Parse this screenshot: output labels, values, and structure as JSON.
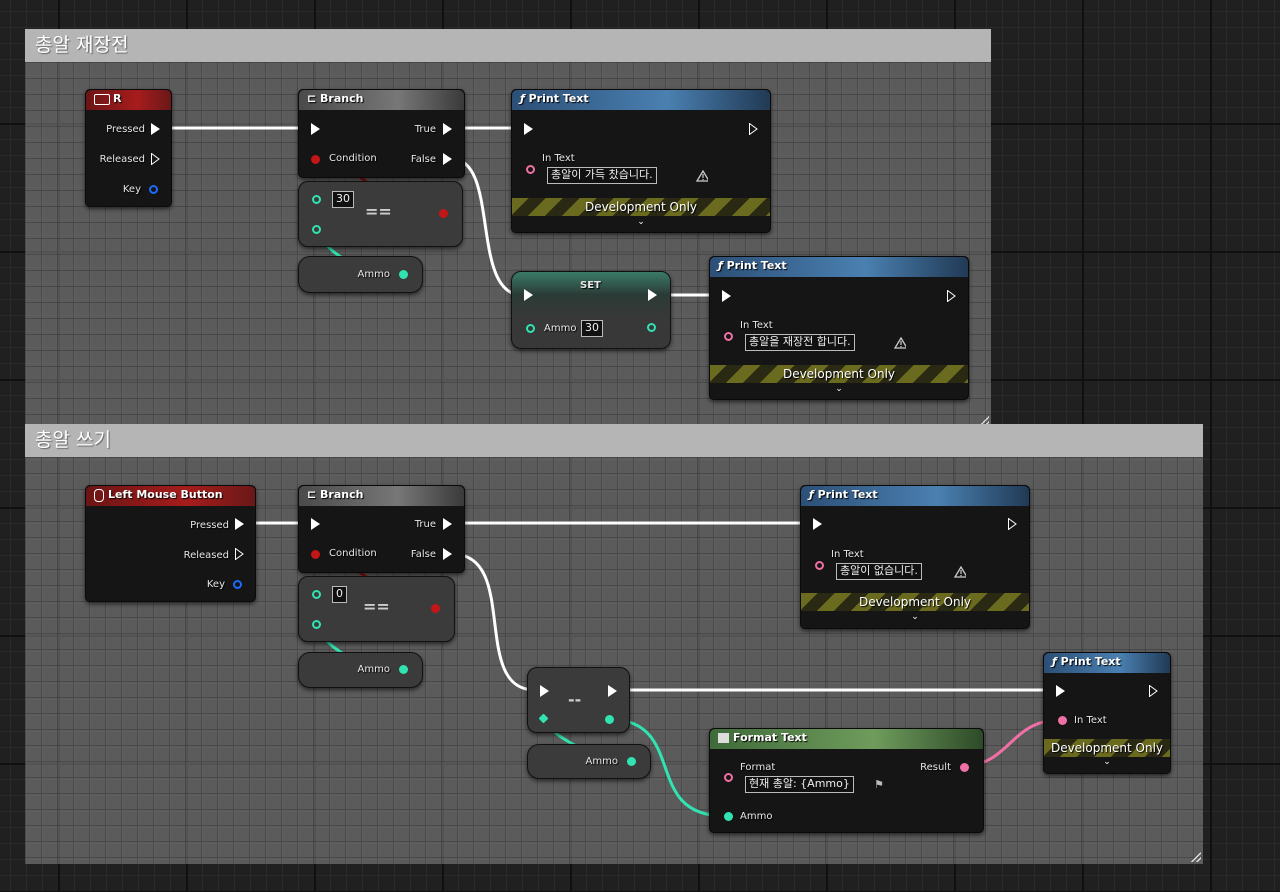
{
  "comments": [
    {
      "title": "총알 재장전"
    },
    {
      "title": "총알 쓰기"
    }
  ],
  "reload": {
    "key_node": {
      "title": "R",
      "pressed": "Pressed",
      "released": "Released",
      "key": "Key"
    },
    "branch": {
      "title": "Branch",
      "condition": "Condition",
      "true": "True",
      "false": "False"
    },
    "equal": {
      "value": "30",
      "op": "=="
    },
    "ammo_getter": {
      "label": "Ammo"
    },
    "print_full": {
      "title": "Print Text",
      "in_text_label": "In Text",
      "in_text": "총알이 가득 찼습니다.",
      "dev": "Development Only"
    },
    "set_node": {
      "title": "SET",
      "ammo_label": "Ammo",
      "ammo_value": "30"
    },
    "print_reload": {
      "title": "Print Text",
      "in_text_label": "In Text",
      "in_text": "총알을 재장전 합니다.",
      "dev": "Development Only"
    }
  },
  "fire": {
    "key_node": {
      "title": "Left Mouse Button",
      "pressed": "Pressed",
      "released": "Released",
      "key": "Key"
    },
    "branch": {
      "title": "Branch",
      "condition": "Condition",
      "true": "True",
      "false": "False"
    },
    "equal": {
      "value": "0",
      "op": "=="
    },
    "ammo_getter": {
      "label": "Ammo"
    },
    "print_empty": {
      "title": "Print Text",
      "in_text_label": "In Text",
      "in_text": "총알이 없습니다.",
      "dev": "Development Only"
    },
    "decrement": {
      "op": "--"
    },
    "ammo_getter2": {
      "label": "Ammo"
    },
    "format_text": {
      "title": "Format Text",
      "format_label": "Format",
      "format_value": "현재 총알: {Ammo}",
      "result": "Result",
      "ammo_label": "Ammo"
    },
    "print_count": {
      "title": "Print Text",
      "in_text_label": "In Text",
      "dev": "Development Only"
    }
  },
  "colors": {
    "exec_wire": "#ffffff",
    "bool_wire": "#8b0f0f",
    "int_wire": "#30e3b0",
    "text_wire": "#f06fa4"
  }
}
